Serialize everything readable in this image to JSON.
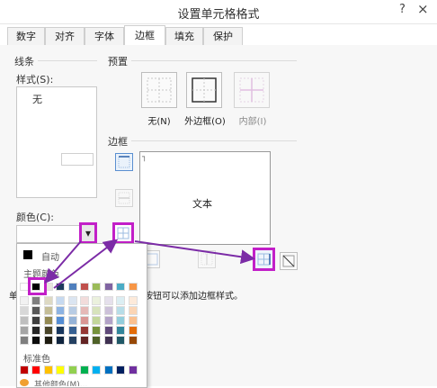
{
  "dialog": {
    "title": "设置单元格格式",
    "help": "?",
    "close": "×"
  },
  "tabs": [
    {
      "label": "数字"
    },
    {
      "label": "对齐"
    },
    {
      "label": "字体"
    },
    {
      "label": "边框",
      "active": true
    },
    {
      "label": "填充"
    },
    {
      "label": "保护"
    }
  ],
  "line": {
    "group": "线条",
    "style_label": "样式(S):",
    "style_none": "无",
    "color_label": "颜色(C):",
    "dropdown_arrow": "▾"
  },
  "presets": {
    "group": "预置",
    "items": [
      {
        "label": "无(N)"
      },
      {
        "label": "外边框(O)"
      },
      {
        "label": "内部(I)"
      }
    ]
  },
  "border": {
    "group": "边框",
    "preview_text": "文本",
    "hint_fragment": "按钮可以添加边框样式。",
    "left_fragment": "单"
  },
  "color_popup": {
    "auto_label": "自动",
    "theme_label": "主题颜色",
    "standard_label": "标准色",
    "more_label": "其他颜色(M)...",
    "theme_top": [
      "#ffffff",
      "#000000",
      "#e8e6de",
      "#1f3a5c",
      "#4f7fbd",
      "#c0504d",
      "#9bbb59",
      "#8064a2",
      "#4bacc6",
      "#f79646"
    ],
    "theme_shades": [
      [
        "#f2f2f2",
        "#7f7f7f",
        "#ddd9c3",
        "#c6d9f0",
        "#dbe5f1",
        "#f2dcdb",
        "#ebf1dd",
        "#e5e0ec",
        "#dbeef3",
        "#fdeada"
      ],
      [
        "#d8d8d8",
        "#595959",
        "#c4bd97",
        "#8db3e2",
        "#b8cce4",
        "#e5b9b7",
        "#d7e3bc",
        "#ccc1d9",
        "#b7dde8",
        "#fbd5b5"
      ],
      [
        "#bfbfbf",
        "#3f3f3f",
        "#938953",
        "#548dd4",
        "#95b3d7",
        "#d99694",
        "#c3d69b",
        "#b2a2c7",
        "#92cddc",
        "#fac08f"
      ],
      [
        "#a5a5a5",
        "#262626",
        "#494429",
        "#17365d",
        "#366092",
        "#953734",
        "#76923c",
        "#5f497a",
        "#31859b",
        "#e36c09"
      ],
      [
        "#7f7f7f",
        "#0c0c0c",
        "#1d1b10",
        "#0f243e",
        "#244061",
        "#632423",
        "#4f6128",
        "#3f3151",
        "#205867",
        "#974806"
      ]
    ],
    "standard": [
      "#c00000",
      "#ff0000",
      "#ffc000",
      "#ffff00",
      "#92d050",
      "#00b050",
      "#00b0f0",
      "#0070c0",
      "#002060",
      "#7030a0"
    ]
  },
  "colors": {
    "highlight": "#c21fc8",
    "arrow": "#7b2ba6"
  }
}
